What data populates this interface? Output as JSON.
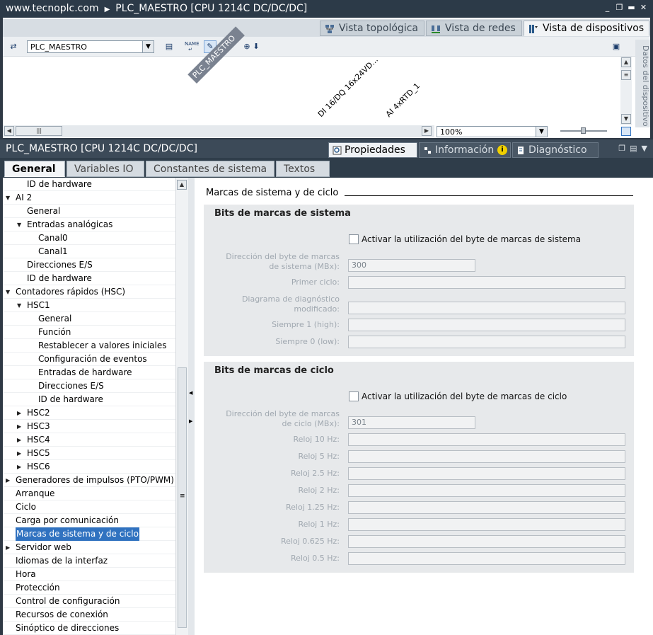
{
  "window": {
    "url": "www.tecnoplc.com",
    "title": "PLC_MAESTRO [CPU 1214C DC/DC/DC]",
    "controls": [
      "_",
      "❐",
      "▬",
      "✕"
    ]
  },
  "view_tabs": [
    {
      "label": "Vista topológica",
      "icon": "topology-icon"
    },
    {
      "label": "Vista de redes",
      "icon": "network-icon"
    },
    {
      "label": "Vista de dispositivos",
      "icon": "device-icon"
    }
  ],
  "toolbar": {
    "device_select": "PLC_MAESTRO"
  },
  "canvas": {
    "devices": [
      "PLC_MAESTRO",
      "DI 16/DQ 16x24VD...",
      "AI 4xRTD_1"
    ]
  },
  "zoom": {
    "value": "100%"
  },
  "side_tab": {
    "label": "Datos del dispositivo"
  },
  "properties_bar": {
    "title": "PLC_MAESTRO [CPU 1214C DC/DC/DC]",
    "tabs": [
      {
        "label": "Propiedades",
        "icon": "properties-icon"
      },
      {
        "label": "Información",
        "icon": "info-icon"
      },
      {
        "label": "Diagnóstico",
        "icon": "diagnostics-icon"
      }
    ]
  },
  "sub_tabs": [
    "General",
    "Variables IO",
    "Constantes de sistema",
    "Textos"
  ],
  "tree": [
    {
      "label": "ID de hardware",
      "level": 2,
      "arrow": ""
    },
    {
      "label": "AI 2",
      "level": 1,
      "arrow": "▼"
    },
    {
      "label": "General",
      "level": 2,
      "arrow": ""
    },
    {
      "label": "Entradas analógicas",
      "level": 2,
      "arrow": "▼"
    },
    {
      "label": "Canal0",
      "level": 3,
      "arrow": ""
    },
    {
      "label": "Canal1",
      "level": 3,
      "arrow": ""
    },
    {
      "label": "Direcciones E/S",
      "level": 2,
      "arrow": ""
    },
    {
      "label": "ID de hardware",
      "level": 2,
      "arrow": ""
    },
    {
      "label": "Contadores rápidos (HSC)",
      "level": 1,
      "arrow": "▼"
    },
    {
      "label": "HSC1",
      "level": 2,
      "arrow": "▼"
    },
    {
      "label": "General",
      "level": 3,
      "arrow": ""
    },
    {
      "label": "Función",
      "level": 3,
      "arrow": ""
    },
    {
      "label": "Restablecer a valores iniciales",
      "level": 3,
      "arrow": ""
    },
    {
      "label": "Configuración de eventos",
      "level": 3,
      "arrow": ""
    },
    {
      "label": "Entradas de hardware",
      "level": 3,
      "arrow": ""
    },
    {
      "label": "Direcciones E/S",
      "level": 3,
      "arrow": ""
    },
    {
      "label": "ID de hardware",
      "level": 3,
      "arrow": ""
    },
    {
      "label": "HSC2",
      "level": 2,
      "arrow": "▶"
    },
    {
      "label": "HSC3",
      "level": 2,
      "arrow": "▶"
    },
    {
      "label": "HSC4",
      "level": 2,
      "arrow": "▶"
    },
    {
      "label": "HSC5",
      "level": 2,
      "arrow": "▶"
    },
    {
      "label": "HSC6",
      "level": 2,
      "arrow": "▶"
    },
    {
      "label": "Generadores de impulsos (PTO/PWM)",
      "level": 1,
      "arrow": "▶"
    },
    {
      "label": "Arranque",
      "level": 1,
      "arrow": ""
    },
    {
      "label": "Ciclo",
      "level": 1,
      "arrow": ""
    },
    {
      "label": "Carga por comunicación",
      "level": 1,
      "arrow": ""
    },
    {
      "label": "Marcas de sistema y de ciclo",
      "level": 1,
      "arrow": "",
      "selected": true
    },
    {
      "label": "Servidor web",
      "level": 1,
      "arrow": "▶"
    },
    {
      "label": "Idiomas de la interfaz",
      "level": 1,
      "arrow": ""
    },
    {
      "label": "Hora",
      "level": 1,
      "arrow": ""
    },
    {
      "label": "Protección",
      "level": 1,
      "arrow": ""
    },
    {
      "label": "Control de configuración",
      "level": 1,
      "arrow": ""
    },
    {
      "label": "Recursos de conexión",
      "level": 1,
      "arrow": ""
    },
    {
      "label": "Sinóptico de direcciones",
      "level": 1,
      "arrow": ""
    }
  ],
  "content": {
    "title": "Marcas de sistema y de ciclo",
    "system": {
      "header": "Bits de marcas de sistema",
      "checkbox_label": "Activar la utilización del byte de marcas de sistema",
      "checked": false,
      "address_label_1": "Dirección del byte de marcas",
      "address_label_2": "de sistema (MBx):",
      "address_value": "300",
      "fields": [
        "Primer ciclo:",
        "Diagrama de diagnóstico|modificado:",
        "Siempre 1 (high):",
        "Siempre 0 (low):"
      ]
    },
    "clock": {
      "header": "Bits de marcas de ciclo",
      "checkbox_label": "Activar la utilización del byte de marcas de ciclo",
      "checked": false,
      "address_label_1": "Dirección del byte de marcas",
      "address_label_2": "de ciclo (MBx):",
      "address_value": "301",
      "fields": [
        "Reloj 10 Hz:",
        "Reloj 5 Hz:",
        "Reloj 2.5 Hz:",
        "Reloj 2 Hz:",
        "Reloj 1.25 Hz:",
        "Reloj 1 Hz:",
        "Reloj 0.625 Hz:",
        "Reloj 0.5 Hz:"
      ]
    }
  }
}
